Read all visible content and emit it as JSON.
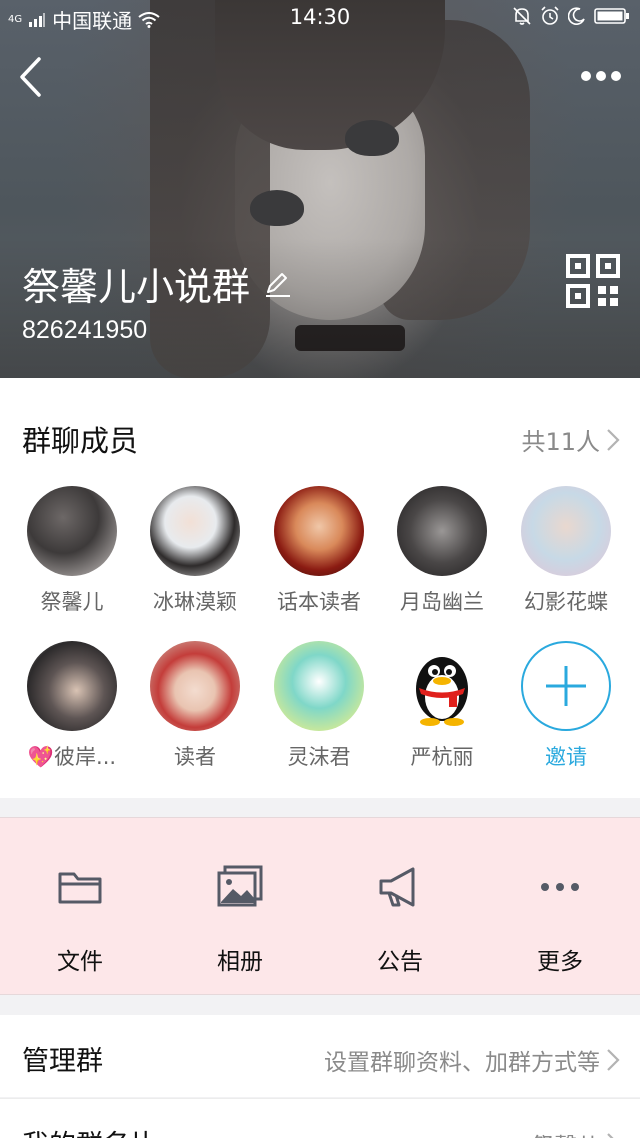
{
  "status_bar": {
    "network": "4G",
    "carrier": "中国联通",
    "time": "14:30"
  },
  "header": {
    "group_name": "祭馨儿小说群",
    "group_id": "826241950"
  },
  "members": {
    "title": "群聊成员",
    "count_label": "共11人",
    "items": [
      {
        "name": "祭馨儿",
        "avatar": "photo-girl-dark-hair"
      },
      {
        "name": "冰琳漠颖",
        "avatar": "photo-girl-white-dress"
      },
      {
        "name": "话本读者",
        "avatar": "photo-girl-red-hair"
      },
      {
        "name": "月岛幽兰",
        "avatar": "anime-dark-character"
      },
      {
        "name": "幻影花蝶",
        "avatar": "anime-girl-pastel"
      },
      {
        "name": "💖彼岸...",
        "avatar": "photo-girl-cap"
      },
      {
        "name": "读者",
        "avatar": "photo-girl-red-beret"
      },
      {
        "name": "灵沫君",
        "avatar": "anime-green-hair"
      },
      {
        "name": "严杭丽",
        "avatar": "qq-penguin"
      }
    ],
    "invite_label": "邀请"
  },
  "tools": [
    {
      "label": "文件",
      "icon": "folder-icon"
    },
    {
      "label": "相册",
      "icon": "album-icon"
    },
    {
      "label": "公告",
      "icon": "megaphone-icon"
    },
    {
      "label": "更多",
      "icon": "more-dots-icon"
    }
  ],
  "rows": [
    {
      "title": "管理群",
      "value": "设置群聊资料、加群方式等"
    },
    {
      "title": "我的群名片",
      "value": "祭馨儿"
    }
  ],
  "colors": {
    "accent": "#2aa9de",
    "tools_bg": "#fde7e9"
  }
}
